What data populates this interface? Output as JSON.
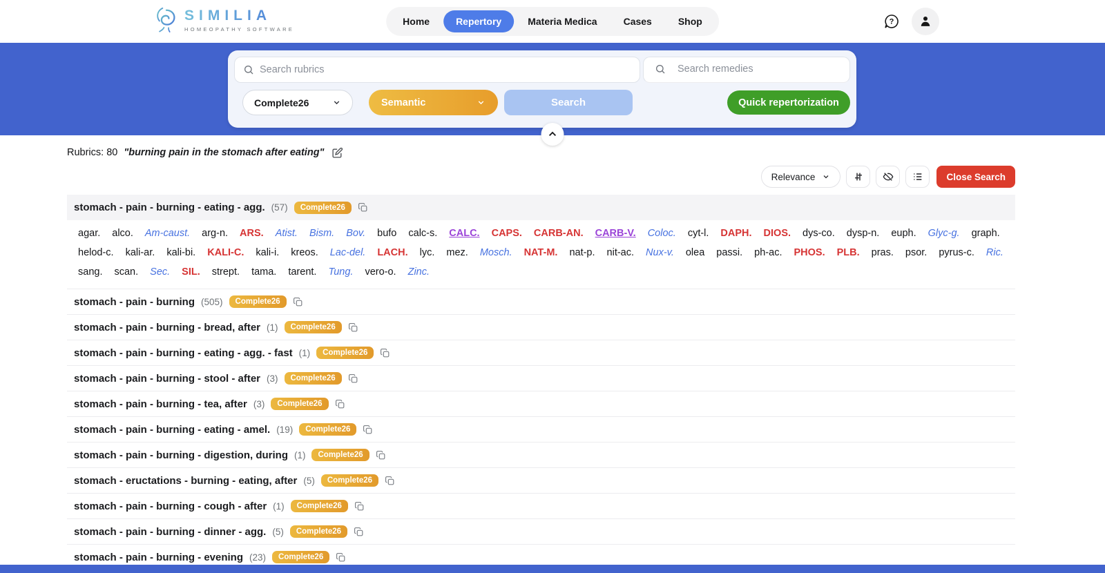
{
  "header": {
    "logo": {
      "title": "SIMILIA",
      "subtitle": "HOMEOPATHY SOFTWARE"
    },
    "nav_items": [
      {
        "id": "home",
        "label": "Home",
        "active": false
      },
      {
        "id": "repertory",
        "label": "Repertory",
        "active": true
      },
      {
        "id": "materia-medica",
        "label": "Materia Medica",
        "active": false
      },
      {
        "id": "cases",
        "label": "Cases",
        "active": false
      },
      {
        "id": "shop",
        "label": "Shop",
        "active": false
      }
    ]
  },
  "search_panel": {
    "rubrics_input": {
      "placeholder": "Search rubrics",
      "value": ""
    },
    "remedies_input": {
      "placeholder": "Search remedies",
      "value": ""
    },
    "repertory_dropdown": "Complete26",
    "mode_dropdown": "Semantic",
    "search_button": "Search",
    "quick_repertorization_button": "Quick repertorization"
  },
  "results": {
    "rubrics_count_label": "Rubrics: 80",
    "query_text": "\"burning pain in the stomach after eating\"",
    "sort_dropdown": "Relevance",
    "close_search_button": "Close Search",
    "badge_label": "Complete26",
    "rows": [
      {
        "text": "stomach - pain - burning - eating - agg.",
        "count": 57,
        "expanded": true
      },
      {
        "text": "stomach - pain - burning",
        "count": 505,
        "expanded": false
      },
      {
        "text": "stomach - pain - burning - bread, after",
        "count": 1,
        "expanded": false
      },
      {
        "text": "stomach - pain - burning - eating - agg. - fast",
        "count": 1,
        "expanded": false
      },
      {
        "text": "stomach - pain - burning - stool - after",
        "count": 3,
        "expanded": false
      },
      {
        "text": "stomach - pain - burning - tea, after",
        "count": 3,
        "expanded": false
      },
      {
        "text": "stomach - pain - burning - eating - amel.",
        "count": 19,
        "expanded": false
      },
      {
        "text": "stomach - pain - burning - digestion, during",
        "count": 1,
        "expanded": false
      },
      {
        "text": "stomach - eructations - burning - eating, after",
        "count": 5,
        "expanded": false
      },
      {
        "text": "stomach - pain - burning - cough - after",
        "count": 1,
        "expanded": false
      },
      {
        "text": "stomach - pain - burning - dinner - agg.",
        "count": 5,
        "expanded": false
      },
      {
        "text": "stomach - pain - burning - evening",
        "count": 23,
        "expanded": false
      }
    ],
    "expanded_remedies": [
      {
        "name": "agar.",
        "degree": 1
      },
      {
        "name": "alco.",
        "degree": 1
      },
      {
        "name": "Am-caust.",
        "degree": 2
      },
      {
        "name": "arg-n.",
        "degree": 1
      },
      {
        "name": "ARS.",
        "degree": 3
      },
      {
        "name": "Atist.",
        "degree": 2
      },
      {
        "name": "Bism.",
        "degree": 2
      },
      {
        "name": "Bov.",
        "degree": 2
      },
      {
        "name": "bufo",
        "degree": 1
      },
      {
        "name": "calc-s.",
        "degree": 1
      },
      {
        "name": "CALC.",
        "degree": 4
      },
      {
        "name": "CAPS.",
        "degree": 3
      },
      {
        "name": "CARB-AN.",
        "degree": 3
      },
      {
        "name": "CARB-V.",
        "degree": 4
      },
      {
        "name": "Coloc.",
        "degree": 2
      },
      {
        "name": "cyt-l.",
        "degree": 1
      },
      {
        "name": "DAPH.",
        "degree": 3
      },
      {
        "name": "DIOS.",
        "degree": 3
      },
      {
        "name": "dys-co.",
        "degree": 1
      },
      {
        "name": "dysp-n.",
        "degree": 1
      },
      {
        "name": "euph.",
        "degree": 1
      },
      {
        "name": "Glyc-g.",
        "degree": 2
      },
      {
        "name": "graph.",
        "degree": 1
      },
      {
        "name": "helod-c.",
        "degree": 1
      },
      {
        "name": "kali-ar.",
        "degree": 1
      },
      {
        "name": "kali-bi.",
        "degree": 1
      },
      {
        "name": "KALI-C.",
        "degree": 3
      },
      {
        "name": "kali-i.",
        "degree": 1
      },
      {
        "name": "kreos.",
        "degree": 1
      },
      {
        "name": "Lac-del.",
        "degree": 2
      },
      {
        "name": "LACH.",
        "degree": 3
      },
      {
        "name": "lyc.",
        "degree": 1
      },
      {
        "name": "mez.",
        "degree": 1
      },
      {
        "name": "Mosch.",
        "degree": 2
      },
      {
        "name": "NAT-M.",
        "degree": 3
      },
      {
        "name": "nat-p.",
        "degree": 1
      },
      {
        "name": "nit-ac.",
        "degree": 1
      },
      {
        "name": "Nux-v.",
        "degree": 2
      },
      {
        "name": "olea",
        "degree": 1
      },
      {
        "name": "passi.",
        "degree": 1
      },
      {
        "name": "ph-ac.",
        "degree": 1
      },
      {
        "name": "PHOS.",
        "degree": 3
      },
      {
        "name": "PLB.",
        "degree": 3
      },
      {
        "name": "pras.",
        "degree": 1
      },
      {
        "name": "psor.",
        "degree": 1
      },
      {
        "name": "pyrus-c.",
        "degree": 1
      },
      {
        "name": "Ric.",
        "degree": 2
      },
      {
        "name": "sang.",
        "degree": 1
      },
      {
        "name": "scan.",
        "degree": 1
      },
      {
        "name": "Sec.",
        "degree": 2
      },
      {
        "name": "SIL.",
        "degree": 3
      },
      {
        "name": "strept.",
        "degree": 1
      },
      {
        "name": "tama.",
        "degree": 1
      },
      {
        "name": "tarent.",
        "degree": 1
      },
      {
        "name": "Tung.",
        "degree": 2
      },
      {
        "name": "vero-o.",
        "degree": 1
      },
      {
        "name": "Zinc.",
        "degree": 2
      }
    ]
  },
  "colors": {
    "hero_blue": "#4263cd",
    "nav_active_blue": "#4e7ce8",
    "semantic_orange_start": "#eebc43",
    "semantic_orange_end": "#e79d2b",
    "search_button_blue": "#a9c4f2",
    "quick_green": "#3f9e28",
    "close_red": "#dc3c2c",
    "badge_orange_start": "#ecb83f",
    "badge_orange_end": "#e29a2b",
    "remedy_degree2_blue": "#4671e0",
    "remedy_degree3_red": "#d63434",
    "remedy_degree4_purple": "#9b44d8"
  }
}
